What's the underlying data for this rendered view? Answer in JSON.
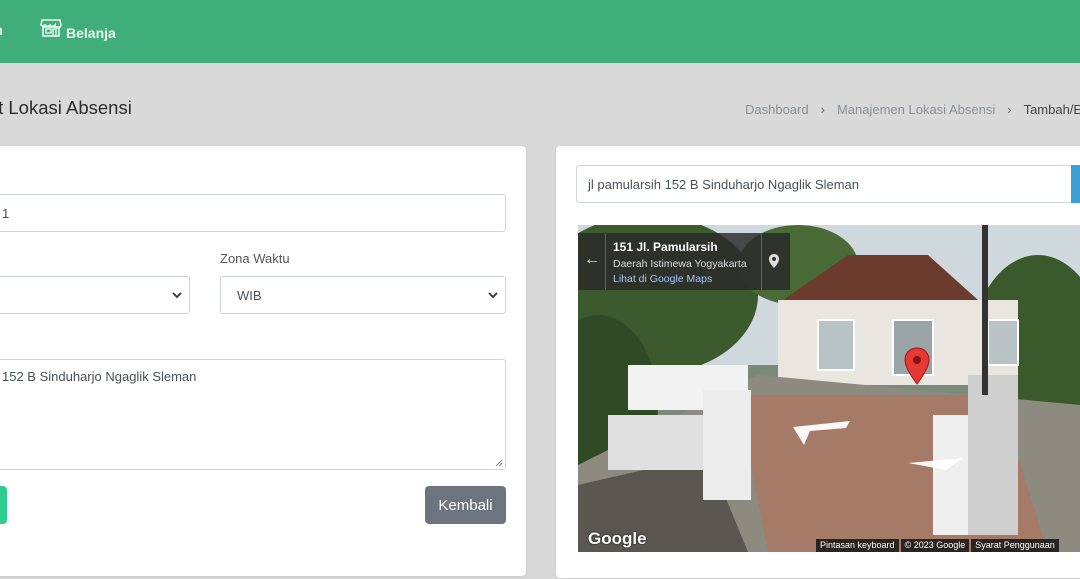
{
  "navbar": {
    "item_partial": "uan",
    "shop_label": "Belanja"
  },
  "page": {
    "title": "it Lokasi Absensi"
  },
  "breadcrumb": {
    "items": [
      "Dashboard",
      "Manajemen Lokasi Absensi",
      "Tambah/E"
    ]
  },
  "form": {
    "name_value": "1",
    "timezone_label": "Zona Waktu",
    "timezone_value": "WIB",
    "address_value": "152 B Sinduharjo Ngaglik Sleman",
    "back_label": "Kembali"
  },
  "map": {
    "search_value": "jl pamularsih 152 B Sinduharjo Ngaglik Sleman",
    "place_title": "151 Jl. Pamularsih",
    "place_region": "Daerah Istimewa Yogyakarta",
    "place_link": "Lihat di Google Maps",
    "logo": "Google",
    "footer": [
      "Pintasan keyboard",
      "© 2023 Google",
      "Syarat Penggunaan"
    ]
  },
  "colors": {
    "navbar": "#3fae7a",
    "back_button": "#6c757d",
    "save_button": "#2ecc8f",
    "search_button": "#3b9fd8",
    "map_pin": "#e53935"
  }
}
